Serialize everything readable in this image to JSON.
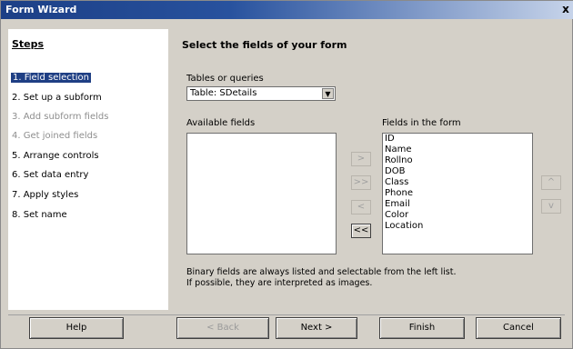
{
  "window": {
    "title": "Form Wizard",
    "close_glyph": "x"
  },
  "steps": {
    "heading": "Steps",
    "items": [
      {
        "label": "1. Field selection",
        "state": "active"
      },
      {
        "label": "2. Set up a subform",
        "state": "normal"
      },
      {
        "label": "3. Add subform fields",
        "state": "disabled"
      },
      {
        "label": "4. Get joined fields",
        "state": "disabled"
      },
      {
        "label": "5. Arrange controls",
        "state": "normal"
      },
      {
        "label": "6. Set data entry",
        "state": "normal"
      },
      {
        "label": "7. Apply styles",
        "state": "normal"
      },
      {
        "label": "8. Set name",
        "state": "normal"
      }
    ]
  },
  "main": {
    "heading": "Select the fields of your form",
    "tables_label": "Tables or queries",
    "tables_value": "Table: SDetails",
    "available_label": "Available fields",
    "available_items": [],
    "fields_label": "Fields in the form",
    "fields_items": [
      "ID",
      "Name",
      "Rollno",
      "DOB",
      "Class",
      "Phone",
      "Email",
      "Color",
      "Location"
    ],
    "move_buttons": {
      "add": ">",
      "add_all": ">>",
      "remove": "<",
      "remove_all": "<<"
    },
    "order_buttons": {
      "up": "^",
      "down": "v"
    },
    "note_line1": "Binary fields are always listed and selectable from the left list.",
    "note_line2": "If possible, they are interpreted as images."
  },
  "buttons": {
    "help": "Help",
    "back": "< Back",
    "next": "Next >",
    "finish": "Finish",
    "cancel": "Cancel"
  }
}
